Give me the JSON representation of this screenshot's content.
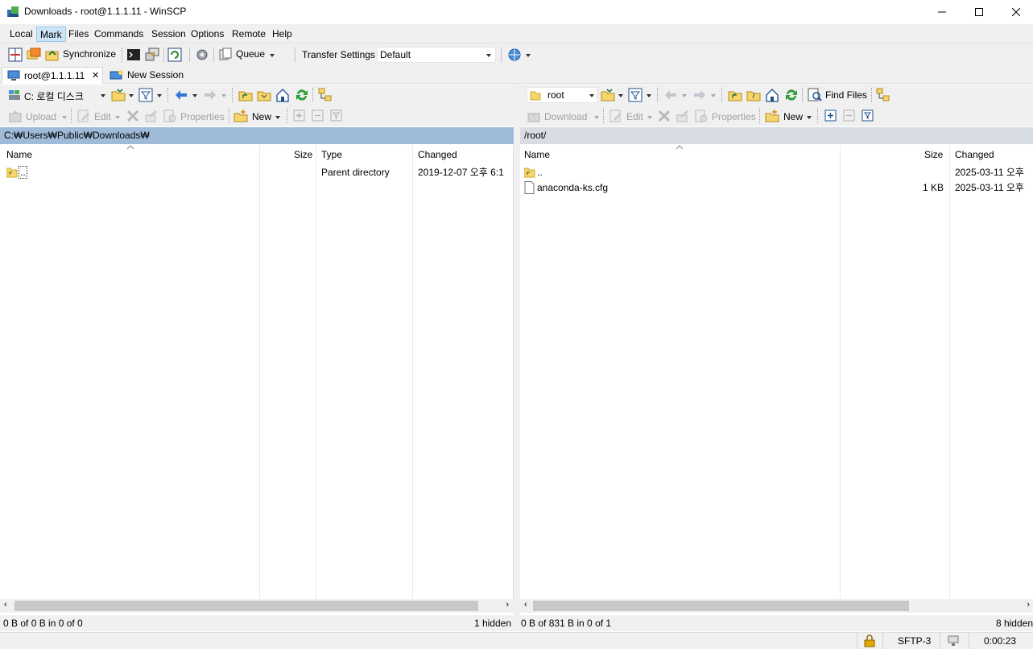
{
  "window": {
    "title": "Downloads - root@1.1.1.11 - WinSCP"
  },
  "menu": [
    "Local",
    "Mark",
    "Files",
    "Commands",
    "Session",
    "Options",
    "Remote",
    "Help"
  ],
  "toolbar": {
    "synchronize": "Synchronize",
    "queue": "Queue",
    "transfer_settings": "Transfer Settings",
    "transfer_preset": "Default"
  },
  "tabs": [
    {
      "label": "root@1.1.1.11",
      "close": "✕"
    },
    {
      "label": "New Session"
    }
  ],
  "local": {
    "drive": "C: 로컬 디스크",
    "upload": "Upload",
    "edit": "Edit",
    "properties": "Properties",
    "new": "New",
    "path": "C:₩Users₩Public₩Downloads₩",
    "columns": {
      "name": "Name",
      "size": "Size",
      "type": "Type",
      "changed": "Changed"
    },
    "rows": [
      {
        "name": "..",
        "size": "",
        "type": "Parent directory",
        "changed": "2019-12-07 오후 6:1"
      }
    ],
    "status_left": "0 B of 0 B in 0 of 0",
    "status_right": "1 hidden"
  },
  "remote": {
    "dir": "root",
    "download": "Download",
    "edit": "Edit",
    "properties": "Properties",
    "new": "New",
    "find_files": "Find Files",
    "path": "/root/",
    "columns": {
      "name": "Name",
      "size": "Size",
      "changed": "Changed"
    },
    "rows": [
      {
        "name": "..",
        "size": "",
        "changed": "2025-03-11 오후"
      },
      {
        "name": "anaconda-ks.cfg",
        "size": "1 KB",
        "changed": "2025-03-11 오후"
      }
    ],
    "status_left": "0 B of 831 B in 0 of 1",
    "status_right": "8 hidden"
  },
  "bottom": {
    "protocol": "SFTP-3",
    "elapsed": "0:00:23"
  },
  "colors": {
    "active_path_bg": "#9fbbd9",
    "inactive_path_bg": "#d8dde3",
    "chrome_bg": "#f0f0f0",
    "folder_yellow": "#f6d66b"
  }
}
